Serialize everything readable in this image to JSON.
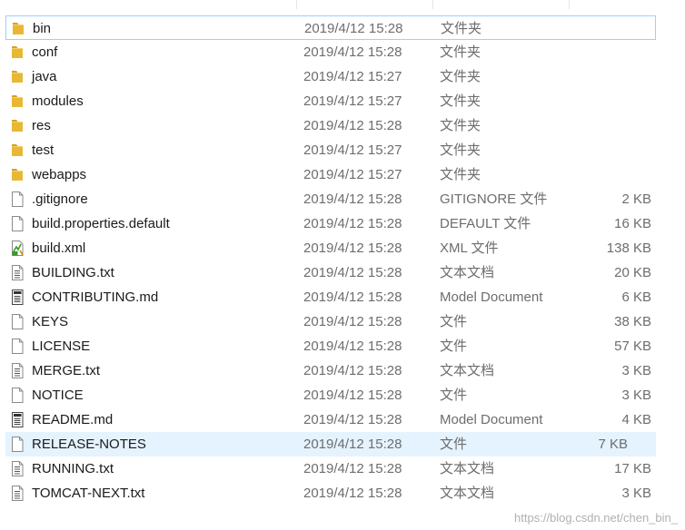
{
  "files": [
    {
      "name": "bin",
      "date": "2019/4/12 15:28",
      "type": "文件夹",
      "size": "",
      "icon": "folder-icon"
    },
    {
      "name": "conf",
      "date": "2019/4/12 15:28",
      "type": "文件夹",
      "size": "",
      "icon": "folder-icon"
    },
    {
      "name": "java",
      "date": "2019/4/12 15:27",
      "type": "文件夹",
      "size": "",
      "icon": "folder-icon"
    },
    {
      "name": "modules",
      "date": "2019/4/12 15:27",
      "type": "文件夹",
      "size": "",
      "icon": "folder-icon"
    },
    {
      "name": "res",
      "date": "2019/4/12 15:28",
      "type": "文件夹",
      "size": "",
      "icon": "folder-icon"
    },
    {
      "name": "test",
      "date": "2019/4/12 15:27",
      "type": "文件夹",
      "size": "",
      "icon": "folder-icon"
    },
    {
      "name": "webapps",
      "date": "2019/4/12 15:27",
      "type": "文件夹",
      "size": "",
      "icon": "folder-icon"
    },
    {
      "name": ".gitignore",
      "date": "2019/4/12 15:28",
      "type": "GITIGNORE 文件",
      "size": "2 KB",
      "icon": "blank-file-icon"
    },
    {
      "name": "build.properties.default",
      "date": "2019/4/12 15:28",
      "type": "DEFAULT 文件",
      "size": "16 KB",
      "icon": "blank-file-icon"
    },
    {
      "name": "build.xml",
      "date": "2019/4/12 15:28",
      "type": "XML 文件",
      "size": "138 KB",
      "icon": "xml-file-icon"
    },
    {
      "name": "BUILDING.txt",
      "date": "2019/4/12 15:28",
      "type": "文本文档",
      "size": "20 KB",
      "icon": "text-file-icon"
    },
    {
      "name": "CONTRIBUTING.md",
      "date": "2019/4/12 15:28",
      "type": "Model Document",
      "size": "6 KB",
      "icon": "markdown-file-icon"
    },
    {
      "name": "KEYS",
      "date": "2019/4/12 15:28",
      "type": "文件",
      "size": "38 KB",
      "icon": "blank-file-icon"
    },
    {
      "name": "LICENSE",
      "date": "2019/4/12 15:28",
      "type": "文件",
      "size": "57 KB",
      "icon": "blank-file-icon"
    },
    {
      "name": "MERGE.txt",
      "date": "2019/4/12 15:28",
      "type": "文本文档",
      "size": "3 KB",
      "icon": "text-file-icon"
    },
    {
      "name": "NOTICE",
      "date": "2019/4/12 15:28",
      "type": "文件",
      "size": "3 KB",
      "icon": "blank-file-icon"
    },
    {
      "name": "README.md",
      "date": "2019/4/12 15:28",
      "type": "Model Document",
      "size": "4 KB",
      "icon": "markdown-file-icon"
    },
    {
      "name": "RELEASE-NOTES",
      "date": "2019/4/12 15:28",
      "type": "文件",
      "size": "7 KB",
      "icon": "blank-file-icon"
    },
    {
      "name": "RUNNING.txt",
      "date": "2019/4/12 15:28",
      "type": "文本文档",
      "size": "17 KB",
      "icon": "text-file-icon"
    },
    {
      "name": "TOMCAT-NEXT.txt",
      "date": "2019/4/12 15:28",
      "type": "文本文档",
      "size": "3 KB",
      "icon": "text-file-icon"
    }
  ],
  "focused_index": 0,
  "hovered_index": 17,
  "watermark": "https://blog.csdn.net/chen_bin_",
  "colors": {
    "folder": "#e8b835",
    "focus_border": "#99d1ff",
    "hover_bg": "#e5f3ff",
    "secondary_text": "#6d6d6d"
  }
}
